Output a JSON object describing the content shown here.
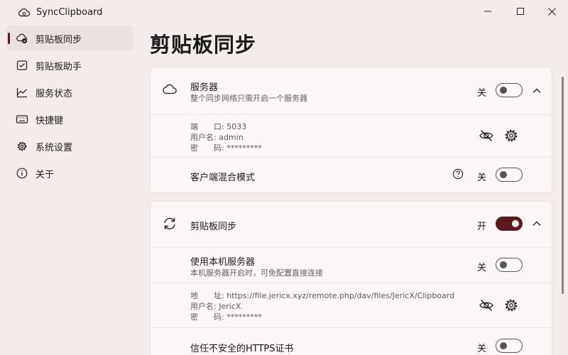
{
  "window": {
    "title": "SyncClipboard",
    "app_icon": "cloud-sync-icon",
    "controls": [
      "minimize-icon",
      "maximize-icon",
      "close-icon"
    ]
  },
  "sidebar": {
    "items": [
      {
        "label": "剪贴板同步",
        "icon": "clipboard-sync-icon",
        "active": true
      },
      {
        "label": "剪贴板助手",
        "icon": "clipboard-assistant-icon",
        "active": false
      },
      {
        "label": "服务状态",
        "icon": "chart-icon",
        "active": false
      },
      {
        "label": "快捷键",
        "icon": "keyboard-icon",
        "active": false
      },
      {
        "label": "系统设置",
        "icon": "gear-icon",
        "active": false
      },
      {
        "label": "关于",
        "icon": "info-icon",
        "active": false
      }
    ]
  },
  "main": {
    "title": "剪贴板同步",
    "server_card": {
      "title": "服务器",
      "subtitle": "整个同步网络只需开启一个服务器",
      "icon": "cloud-icon",
      "toggle_label": "关",
      "enabled": false,
      "info": {
        "port": "端　　口: 5033",
        "username": "用户名: admin",
        "password": "密　　码: *********"
      },
      "hide_icon": "eye-off-icon",
      "settings_icon": "gear-icon",
      "mixed_mode": {
        "title": "客户端混合模式",
        "help_icon": "question-icon",
        "toggle_label": "关",
        "enabled": false
      }
    },
    "sync_card": {
      "title": "剪贴板同步",
      "icon": "sync-arrows-icon",
      "toggle_label": "开",
      "enabled": true,
      "local_server": {
        "title": "使用本机服务器",
        "subtitle": "本机服务器开启时，可免配置直接连接",
        "toggle_label": "关",
        "enabled": false
      },
      "info": {
        "address": "地　　址: https://file.jericx.xyz/remote.php/dav/files/JericX/Clipboard",
        "username": "用户名: JericX",
        "password": "密　　码: *********"
      },
      "hide_icon": "eye-off-icon",
      "settings_icon": "gear-icon",
      "trust_https": {
        "title": "信任不安全的HTTPS证书",
        "toggle_label": "关",
        "enabled": false
      }
    }
  },
  "colors": {
    "accent": "#5a1a1d",
    "background": "#f4ecea",
    "card": "#fbf7f6"
  }
}
